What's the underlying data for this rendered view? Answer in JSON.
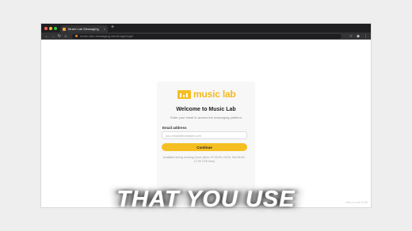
{
  "browser": {
    "tab_title": "Music Lab Messaging",
    "new_tab_symbol": "+",
    "tab_close_symbol": "×",
    "url": "music-lab-messaging.vercel.app/login",
    "nav_icons": [
      "back-icon",
      "forward-icon",
      "reload-icon",
      "home-icon"
    ],
    "toolbar_icons": [
      "star-icon",
      "extensions-icon",
      "menu-icon"
    ]
  },
  "login": {
    "logo_text": "music lab",
    "title": "Welcome to Music Lab",
    "subtitle": "Enter your email to access the messaging platform",
    "email_label": "Email address",
    "email_placeholder": "you.email@example.com",
    "email_value": "",
    "continue_label": "Continue",
    "hours_text": "Available during working hours (Mon–Fri 09:00–18:00, Sat 09:00–17:00 CZE time)"
  },
  "caption": "THAT YOU USE",
  "watermark": "cfds.io.cat.2026",
  "colors": {
    "accent": "#f5bf24",
    "browser_chrome": "#333336",
    "tab_bar": "#1f1f21",
    "background": "#eeeeee"
  }
}
